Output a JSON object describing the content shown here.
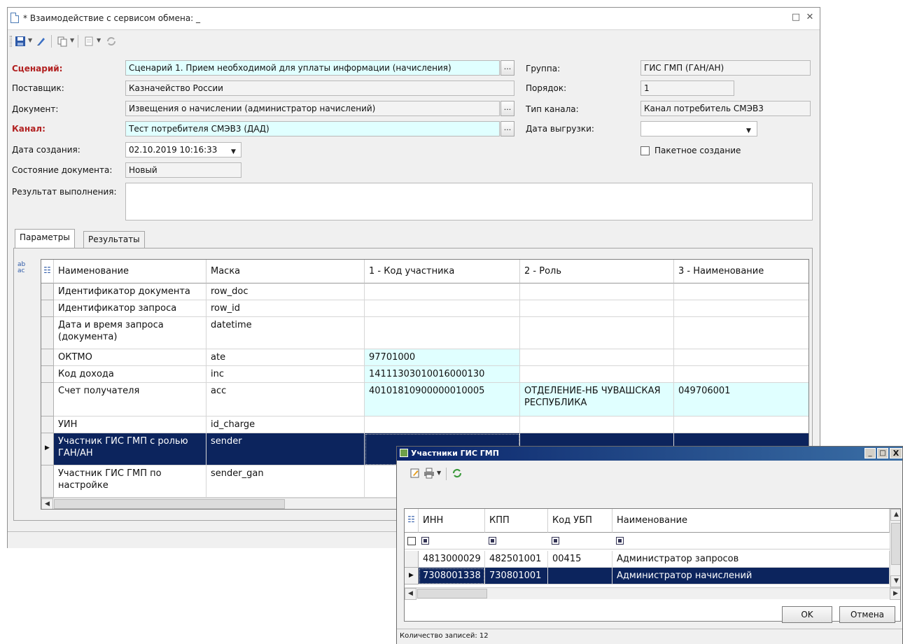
{
  "window": {
    "title": "* Взаимодействие с сервисом обмена: _",
    "controls": [
      "□",
      "✕"
    ]
  },
  "form": {
    "scenario_label": "Сценарий:",
    "scenario_value": "Сценарий 1. Прием необходимой для уплаты информации (начисления)",
    "supplier_label": "Поставщик:",
    "supplier_value": "Казначейство России",
    "document_label": "Документ:",
    "document_value": "Извещения о начислении (администратор начислений)",
    "channel_label": "Канал:",
    "channel_value": "Тест потребителя СМЭВ3 (ДАД)",
    "created_label": "Дата создания:",
    "created_value": "02.10.2019 10:16:33",
    "state_label": "Состояние документа:",
    "state_value": "Новый",
    "result_label": "Результат выполнения:",
    "result_value": "",
    "group_label": "Группа:",
    "group_value": "ГИС ГМП (ГАН/АН)",
    "order_label": "Порядок:",
    "order_value": "1",
    "channel_type_label": "Тип канала:",
    "channel_type_value": "Канал потребитель СМЭВ3",
    "export_date_label": "Дата выгрузки:",
    "export_date_value": "",
    "batch_label": "Пакетное создание",
    "ellipsis": "..."
  },
  "tabs": [
    {
      "label": "Параметры"
    },
    {
      "label": "Результаты"
    }
  ],
  "grid": {
    "columns": [
      "Наименование",
      "Маска",
      "1 - Код участника",
      "2 - Роль",
      "3 - Наименование"
    ],
    "rows": [
      [
        "Идентификатор документа",
        "row_doc",
        "",
        "",
        ""
      ],
      [
        "Идентификатор запроса",
        "row_id",
        "",
        "",
        ""
      ],
      [
        "Дата и время запроса (документа)",
        "datetime",
        "",
        "",
        ""
      ],
      [
        "ОКТМО",
        "ate",
        "97701000",
        "",
        ""
      ],
      [
        "Код дохода",
        "inc",
        "14111303010016000130",
        "",
        ""
      ],
      [
        "Счет получателя",
        "acc",
        "40101810900000010005",
        "ОТДЕЛЕНИЕ-НБ ЧУВАШСКАЯ РЕСПУБЛИКА",
        "049706001"
      ],
      [
        "УИН",
        "id_charge",
        "",
        "",
        ""
      ],
      [
        "Участник ГИС ГМП с ролью ГАН/АН",
        "sender",
        "",
        "",
        ""
      ],
      [
        "Участник ГИС ГМП по настройке",
        "sender_gan",
        "",
        "",
        ""
      ]
    ]
  },
  "dialog": {
    "title": "Участники ГИС ГМП",
    "controls": [
      "_",
      "□",
      "X"
    ],
    "columns": [
      "ИНН",
      "КПП",
      "Код УБП",
      "Наименование"
    ],
    "rows": [
      [
        "4813000029",
        "482501001",
        "00415",
        "Администратор запросов"
      ],
      [
        "7308001338",
        "730801001",
        "",
        "Администратор начислений"
      ]
    ],
    "ok_label": "OK",
    "cancel_label": "Отмена",
    "status": "Количество записей: 12"
  },
  "colors": {
    "selection": "#0c245d",
    "highlight_cell": "#e0ffff",
    "required_label": "#b22222"
  }
}
